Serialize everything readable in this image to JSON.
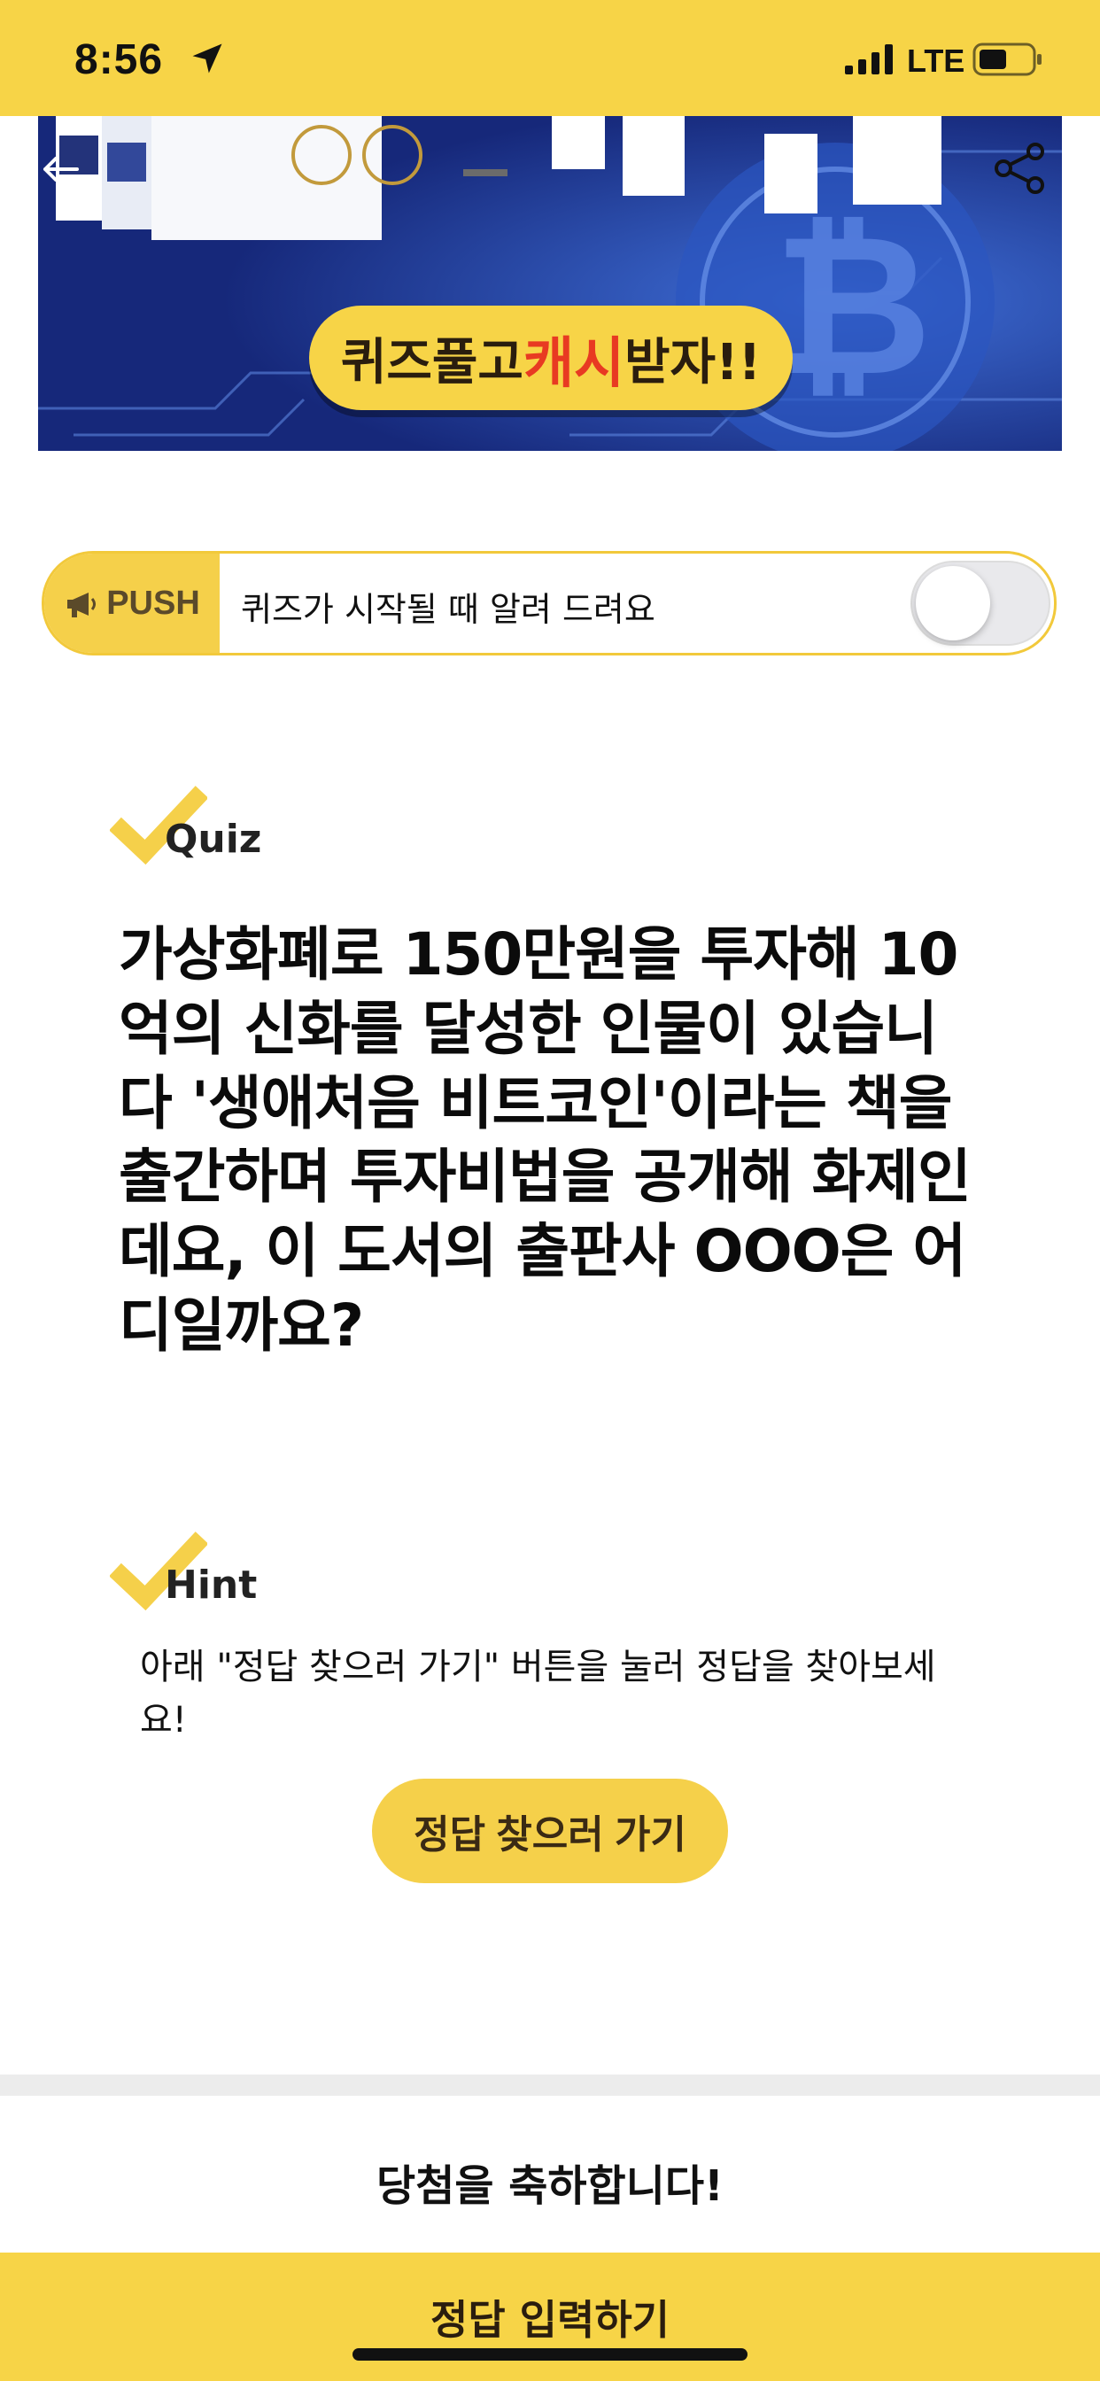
{
  "status_bar": {
    "time": "8:56",
    "network": "LTE"
  },
  "banner": {
    "pill_pre": "퀴즈풀고 ",
    "pill_highlight": "캐시",
    "pill_post": "받자!!"
  },
  "push": {
    "tag": "PUSH",
    "message": "퀴즈가 시작될 때 알려 드려요",
    "toggle_on": false
  },
  "quiz": {
    "label": "Quiz",
    "question": "가상화폐로 150만원을 투자해 10억의 신화를 달성한 인물이 있습니다 '생애처음 비트코인'이라는 책을 출간하며 투자비법을 공개해 화제인데요, 이 도서의 출판사 OOO은 어디일까요?"
  },
  "hint": {
    "label": "Hint",
    "text": "아래 \"정답 찾으러 가기\" 버튼을 눌러 정답을 찾아보세요!",
    "button": "정답 찾으러 가기"
  },
  "congrats": "당첨을 축하합니다!",
  "bottom_button": "정답 입력하기",
  "colors": {
    "accent": "#f7d447",
    "banner_bg": "#1b2f8c",
    "highlight_red": "#e83a22"
  }
}
